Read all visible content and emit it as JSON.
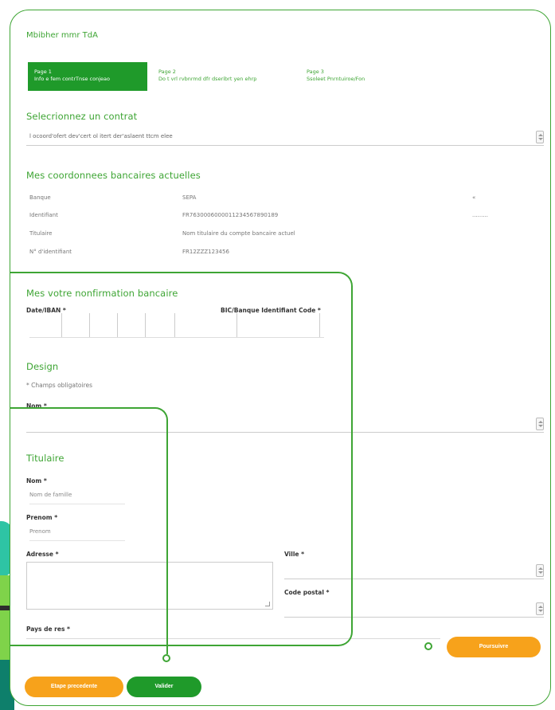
{
  "page": {
    "heading": "Mbibher mmr TdA"
  },
  "stepper": [
    {
      "title": "Page 1",
      "subtitle": "Info e fem contrTnse conjeao"
    },
    {
      "title": "Page 2",
      "subtitle": "Do t vrl rvbnrmd dfr dseribrt yen ehrp"
    },
    {
      "title": "Page 3",
      "subtitle": "Ssoleet Pnrntuiroe/Fon"
    }
  ],
  "contract": {
    "title": "Selecrionnez un contrat",
    "select_value": "l ocoord'ofert dev'cert ol itert der'aslaent ttcm elee"
  },
  "banking": {
    "title": "Mes coordonnees bancaires actuelles",
    "rows": [
      {
        "label": "Banque",
        "value": "SEPA",
        "extra": "«"
      },
      {
        "label": "Identifiant",
        "value": "FR7630006000011234567890189",
        "extra": "........."
      },
      {
        "label": "Titulaire",
        "value": "Nom titulaire du compte bancaire actuel",
        "extra": ""
      },
      {
        "label": "N° d'identifiant",
        "value": "FR12ZZZ123456",
        "extra": ""
      }
    ]
  },
  "new_bank": {
    "title": "Mes votre nonfirmation bancaire",
    "date_label": "Date/IBAN *",
    "bic_label": "BIC/Banque Identifiant Code *"
  },
  "design": {
    "title": "Design",
    "required_note": "* Champs obligatoires",
    "name_label": "Nom *"
  },
  "holder": {
    "title": "Titulaire",
    "nom_label": "Nom *",
    "nom_placeholder": "Nom de famille",
    "prenom_label": "Prenom *",
    "prenom_placeholder": "Prenom",
    "address_label": "Adresse *",
    "ville_label": "Ville *",
    "cp_label": "Code postal *",
    "pays_label": "Pays de res *"
  },
  "buttons": {
    "prev": "Etape precedente",
    "validate": "Valider",
    "next": "Poursuivre"
  },
  "colors": {
    "accent": "#3ea534",
    "primary_button": "#1f9a2a",
    "secondary_button": "#f7a21b"
  }
}
